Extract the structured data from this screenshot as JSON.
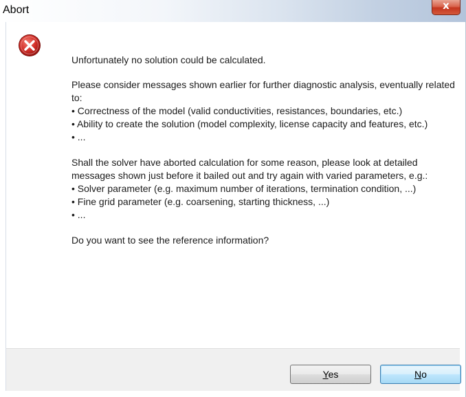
{
  "window": {
    "title": "Abort",
    "close_glyph": "x"
  },
  "message": {
    "icon": "error-icon",
    "heading": "Unfortunately no solution could be calculated.",
    "para1": "Please consider messages shown earlier for further diagnostic analysis, eventually related to:",
    "list1": [
      "• Correctness of the model (valid conductivities, resistances, boundaries, etc.)",
      "• Ability to create the solution (model complexity, license capacity and features, etc.)",
      "• ..."
    ],
    "para2": "Shall the solver have aborted calculation for some reason, please look at detailed messages shown just before it bailed out and try again with varied parameters, e.g.:",
    "list2": [
      "• Solver parameter (e.g. maximum number of iterations, termination condition, ...)",
      "• Fine grid parameter (e.g. coarsening, starting thickness, ...)",
      "• ..."
    ],
    "question": "Do you want to see the reference information?"
  },
  "buttons": {
    "yes_mnemonic": "Y",
    "yes_rest": "es",
    "no_mnemonic": "N",
    "no_rest": "o"
  },
  "colors": {
    "error_red": "#c8282a",
    "close_red": "#c4361f",
    "default_button_border": "#3c7fb1"
  }
}
